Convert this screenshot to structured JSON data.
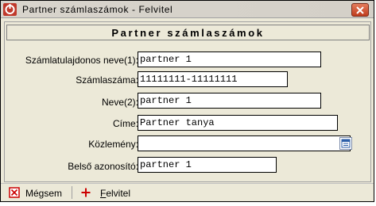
{
  "window": {
    "title": "Partner számlaszámok - Felvitel"
  },
  "header": {
    "title": "Partner számlaszámok"
  },
  "form": {
    "fields": [
      {
        "label": "Számlatulajdonos neve(1):",
        "value": "partner 1"
      },
      {
        "label": "Számlaszáma:",
        "value": "11111111-11111111"
      },
      {
        "label": "Neve(2):",
        "value": "partner 1"
      },
      {
        "label": "Címe:",
        "value": "Partner tanya"
      },
      {
        "label": "Közlemény:",
        "value": ""
      },
      {
        "label": "Belső azonosító:",
        "value": "partner 1"
      }
    ]
  },
  "toolbar": {
    "cancel_label": "Mégsem",
    "cancel_accel": "g",
    "save_label": "Felvitel",
    "save_accel": "F"
  },
  "colors": {
    "cancel_icon": "#cc0000",
    "add_icon": "#cc0000",
    "app_icon": "#c0392b"
  },
  "icons": [
    "app-logo-icon",
    "close-icon",
    "lookup-icon",
    "cancel-icon",
    "plus-icon"
  ]
}
